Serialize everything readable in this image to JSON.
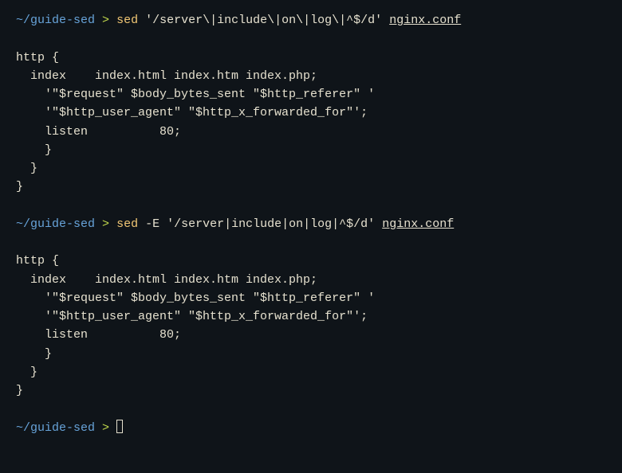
{
  "prompt": {
    "path": "~/guide-sed",
    "arrow": ">"
  },
  "block1": {
    "cmd": "sed",
    "arg": "'/server\\|include\\|on\\|log\\|^$/d'",
    "file": "nginx.conf",
    "out": [
      "http {",
      "  index    index.html index.htm index.php;",
      "    '\"$request\" $body_bytes_sent \"$http_referer\" '",
      "    '\"$http_user_agent\" \"$http_x_forwarded_for\"';",
      "    listen          80;",
      "    }",
      "  }",
      "}"
    ]
  },
  "block2": {
    "cmd": "sed",
    "flag": "-E",
    "arg": "'/server|include|on|log|^$/d'",
    "file": "nginx.conf",
    "out": [
      "http {",
      "  index    index.html index.htm index.php;",
      "    '\"$request\" $body_bytes_sent \"$http_referer\" '",
      "    '\"$http_user_agent\" \"$http_x_forwarded_for\"';",
      "    listen          80;",
      "    }",
      "  }",
      "}"
    ]
  }
}
